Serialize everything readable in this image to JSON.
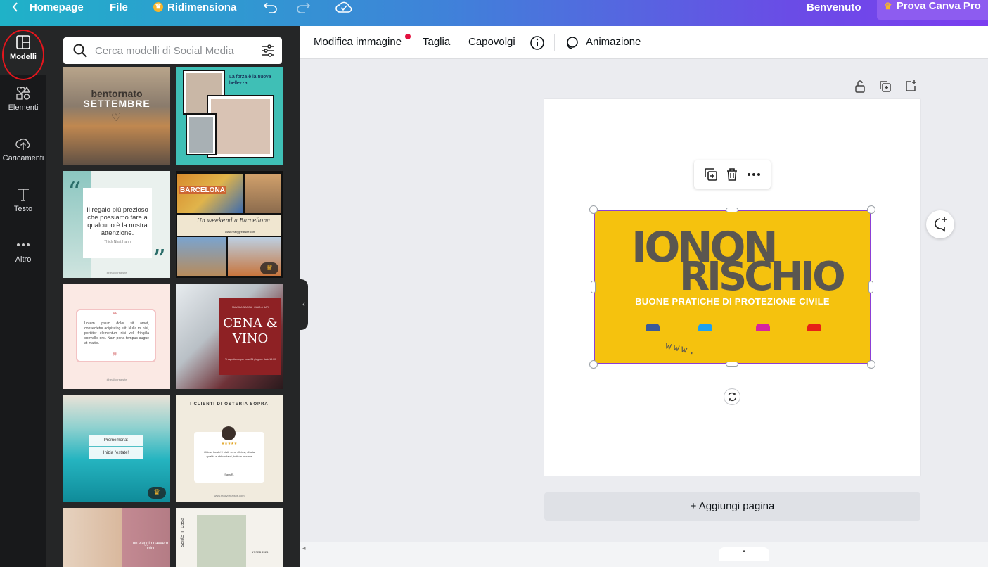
{
  "topbar": {
    "home": "Homepage",
    "file": "File",
    "resize": "Ridimensiona",
    "welcome": "Benvenuto",
    "pro": "Prova Canva Pro"
  },
  "rail": {
    "items": [
      {
        "label": "Modelli"
      },
      {
        "label": "Elementi"
      },
      {
        "label": "Caricamenti"
      },
      {
        "label": "Testo"
      },
      {
        "label": "Altro"
      }
    ]
  },
  "search": {
    "placeholder": "Cerca modelli di Social Media"
  },
  "templates": [
    {
      "line1": "bentornato",
      "line2": "SETTEMBRE"
    },
    {
      "text": "La forza è la nuova bellezza"
    },
    {
      "quote": "Il regalo più prezioso che possiamo fare a qualcuno è la nostra attenzione.",
      "author": "Thich Nhat Hanh",
      "handle": "@reallygreatsite"
    },
    {
      "title": "BARCELONA",
      "subtitle": "Un weekend a Barcellona",
      "url": "www.reallygreatsite.com"
    },
    {
      "body": "Lorem ipsum dolor sit amet, consectetur adipiscing elit. Nulla mi nisi, porttitor elementum nisi vel, fringilla convallis orci. Nam porta tempus augue at mattis.",
      "handle": "@reallygreatsite"
    },
    {
      "pre": "NUVOLA BIANCA · CLUB & BAR",
      "title": "CENA & VINO",
      "info": "Ti aspettiamo per cena 21 giugno - dalle 19:00"
    },
    {
      "label": "Promemoria:",
      "text": "Inizia l'estate!"
    },
    {
      "title": "I CLIENTI DI OSTERIA SOPRA",
      "stars": "★★★★★",
      "review": "Ottimo locale! I piatti sono sfiziosi, di alta qualità e abbondanti, tutti da provare",
      "name": "Sara R.",
      "url": "www.reallygreatsite.com"
    },
    {
      "text": "un viaggio davvero unico"
    },
    {
      "vertical": "sente in casa",
      "date": "17 FEB 2024"
    }
  ],
  "toolbar": {
    "edit_image": "Modifica immagine",
    "crop": "Taglia",
    "flip": "Capovolgi",
    "animation": "Animazione"
  },
  "design": {
    "title_line1": "IONON",
    "title_line2": "RISCHIO",
    "subtitle": "BUONE PRATICHE DI PROTEZIONE CIVILE",
    "www": "www.",
    "colors": {
      "background": "#f5c20e",
      "text": "#5a5650",
      "subtitle": "#ffffff",
      "selection": "#8b3fd6"
    }
  },
  "add_page": "+ Aggiungi pagina",
  "accent": {
    "brand_gradient": [
      "#1fb2c8",
      "#7b3df0"
    ],
    "pro_button": "#8d5cf0",
    "notification": "#e3113f"
  }
}
